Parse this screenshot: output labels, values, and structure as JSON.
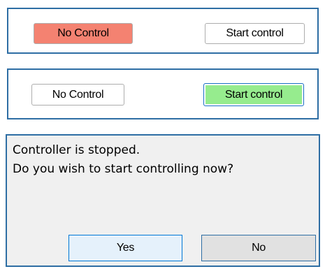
{
  "panel_stopped": {
    "no_control_label": "No Control",
    "start_control_label": "Start control",
    "active_color": "#f48271"
  },
  "panel_running": {
    "no_control_label": "No Control",
    "start_control_label": "Start control",
    "active_color": "#96ec8e"
  },
  "dialog": {
    "message_line1": "Controller is stopped.",
    "message_line2": "Do you wish to start controlling now?",
    "yes_label": "Yes",
    "no_label": "No"
  },
  "colors": {
    "panel_border": "#2e6ea4",
    "dialog_background": "#f0f0f0",
    "focus_border": "#0078d7"
  }
}
